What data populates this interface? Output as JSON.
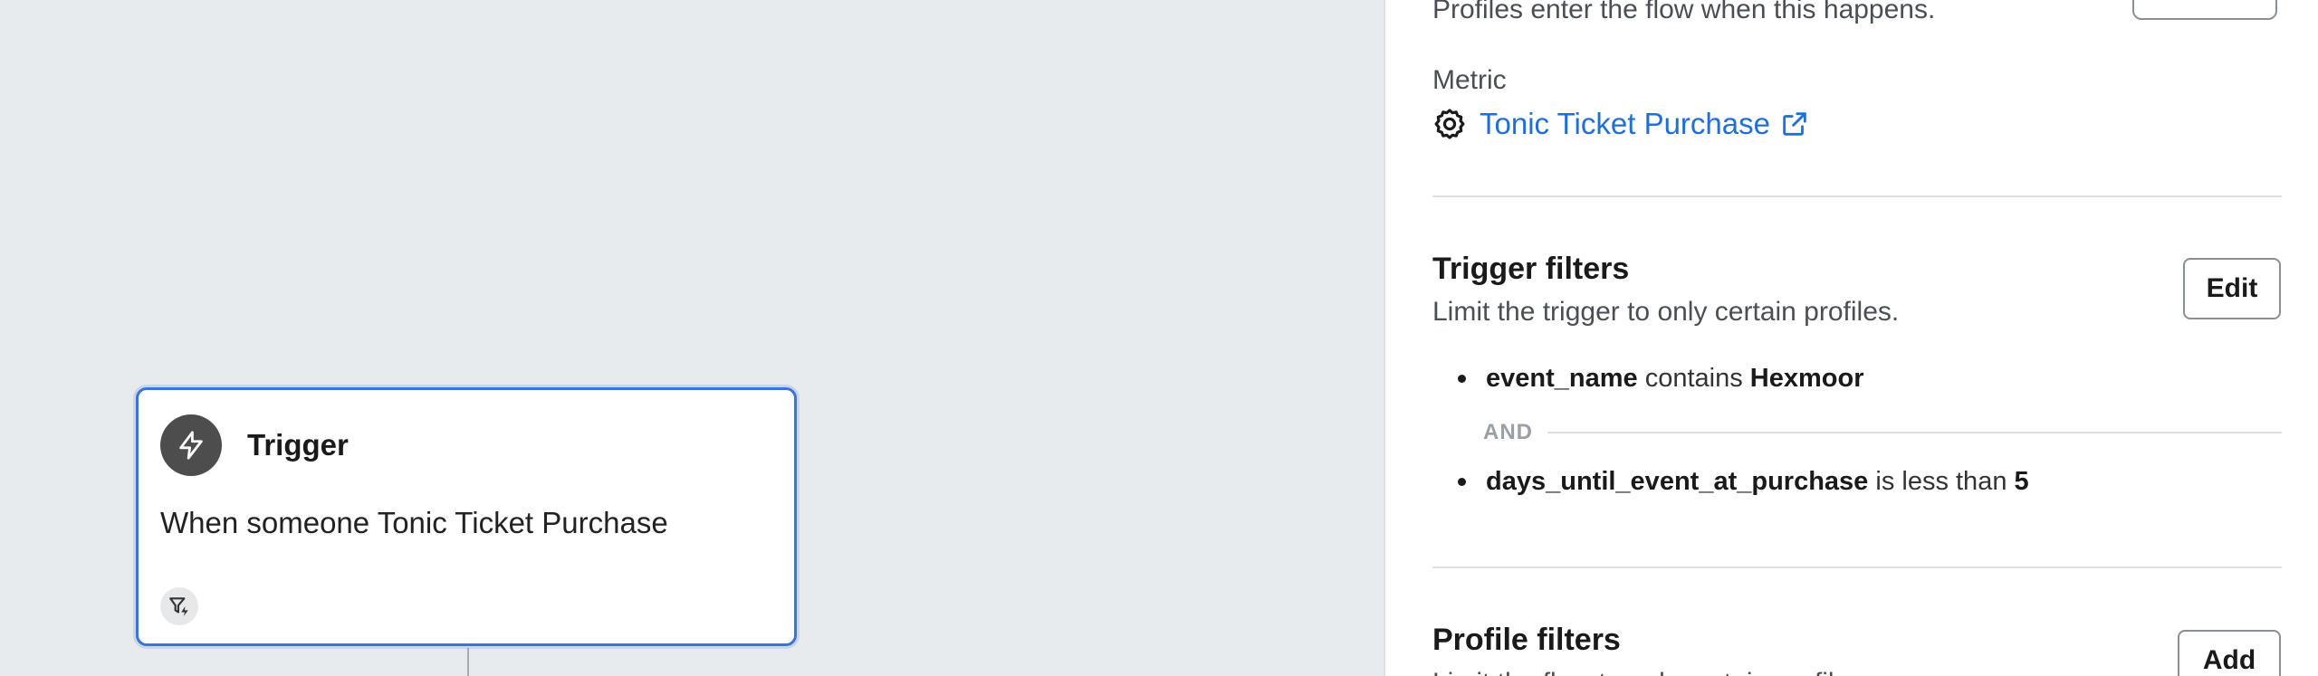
{
  "trigger_card": {
    "title": "Trigger",
    "description": "When someone Tonic Ticket Purchase",
    "icon": "lightning-icon",
    "filter_badge_icon": "filter-lightning-icon"
  },
  "panel": {
    "truncated_description": "Profiles enter the flow when this happens.",
    "metric": {
      "label": "Metric",
      "value": "Tonic Ticket Purchase",
      "icon": "gear-icon",
      "link_icon": "external-link-icon"
    },
    "trigger_filters": {
      "title": "Trigger filters",
      "description": "Limit the trigger to only certain profiles.",
      "button_label": "Edit",
      "conditions": [
        {
          "field": "event_name",
          "operator": "contains",
          "value": "Hexmoor"
        },
        {
          "field": "days_until_event_at_purchase",
          "operator": "is less than",
          "value": "5"
        }
      ],
      "joiner": "AND"
    },
    "profile_filters": {
      "title": "Profile filters",
      "description": "Limit the flow to only certain profiles.",
      "button_label": "Add"
    }
  },
  "colors": {
    "canvas_bg": "#e8ebee",
    "accent": "#3b73d9",
    "link": "#1f6fd6"
  }
}
